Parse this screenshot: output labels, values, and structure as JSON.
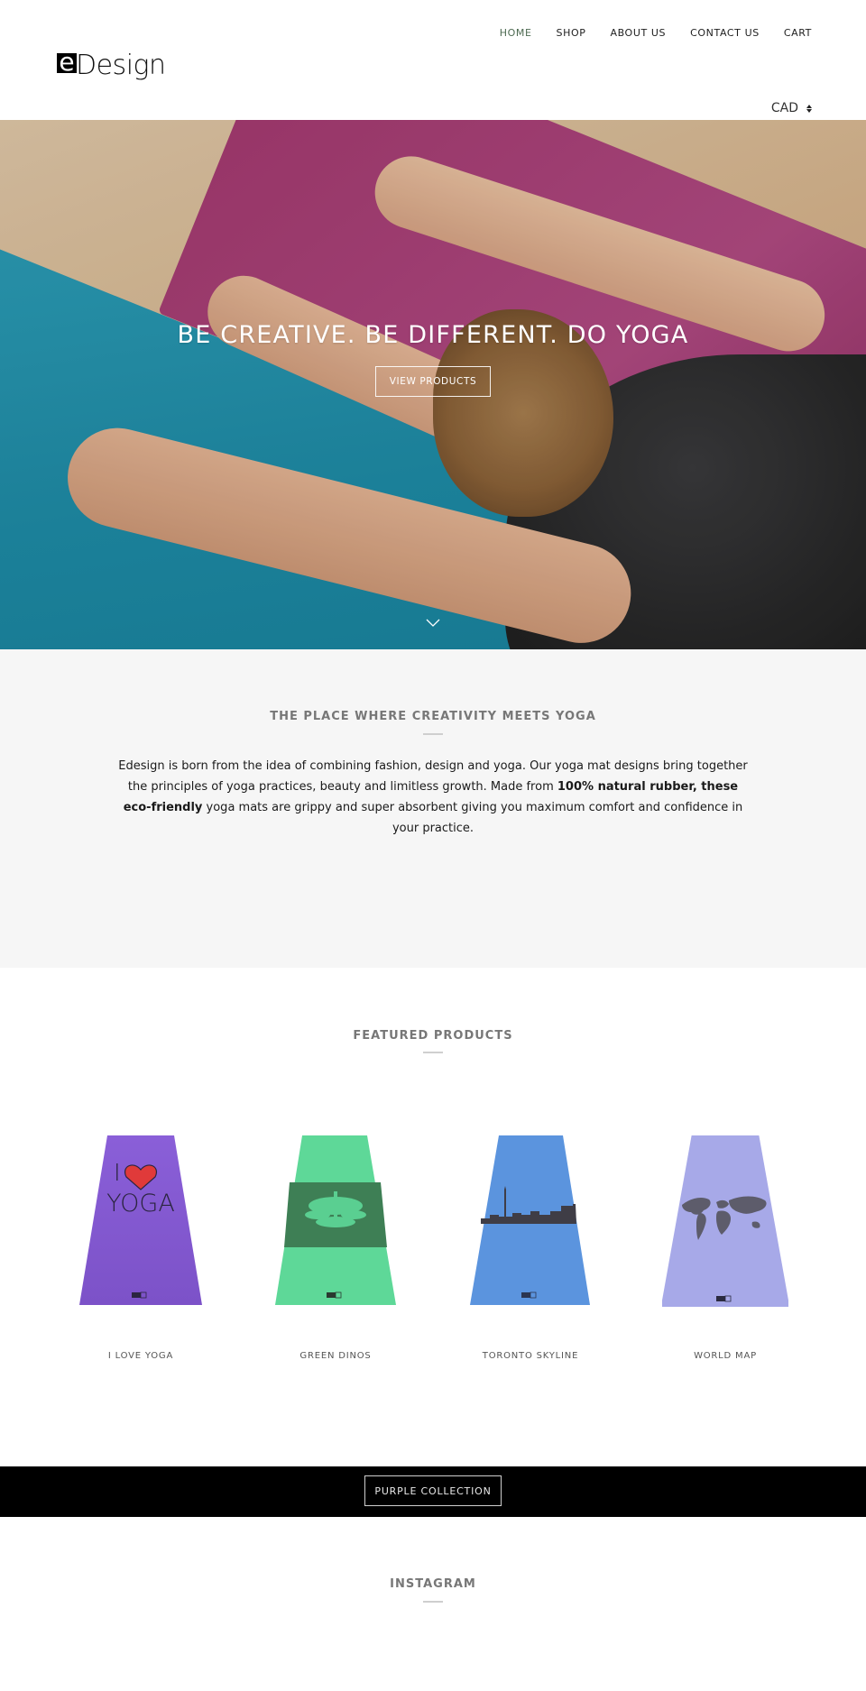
{
  "brand": {
    "logo_mark": "e",
    "logo_text": "Design"
  },
  "nav": {
    "items": [
      {
        "label": "HOME",
        "active": true
      },
      {
        "label": "SHOP",
        "active": false
      },
      {
        "label": "ABOUT US",
        "active": false
      },
      {
        "label": "CONTACT US",
        "active": false
      },
      {
        "label": "CART",
        "active": false
      }
    ],
    "active_color": "#4e6b52"
  },
  "currency": {
    "selected": "CAD"
  },
  "hero": {
    "title": "BE CREATIVE. BE DIFFERENT. DO YOGA",
    "button_label": "VIEW PRODUCTS",
    "scroll_icon": "chevron-down-icon"
  },
  "about": {
    "title": "THE PLACE WHERE CREATIVITY MEETS YOGA",
    "text_before": "Edesign is born from the idea of combining fashion, design and yoga. Our yoga mat designs bring together the principles of yoga practices, beauty and limitless growth. Made from ",
    "text_bold": "100% natural rubber, these eco-friendly",
    "text_after": " yoga mats are grippy and super absorbent giving you maximum comfort and confidence in your practice."
  },
  "featured": {
    "title": "FEATURED PRODUCTS",
    "products": [
      {
        "name": "I LOVE YOGA",
        "color": "#8b63d6",
        "design": "I ♥ YOGA"
      },
      {
        "name": "GREEN DINOS",
        "color": "#5fd494",
        "design": "dinosaur band"
      },
      {
        "name": "TORONTO SKYLINE",
        "color": "#5a93dd",
        "design": "skyline silhouette"
      },
      {
        "name": "WORLD MAP",
        "color": "#a9a9e6",
        "design": "world map"
      }
    ]
  },
  "banner": {
    "button_label": "PURPLE COLLECTION"
  },
  "instagram": {
    "title": "INSTAGRAM"
  }
}
